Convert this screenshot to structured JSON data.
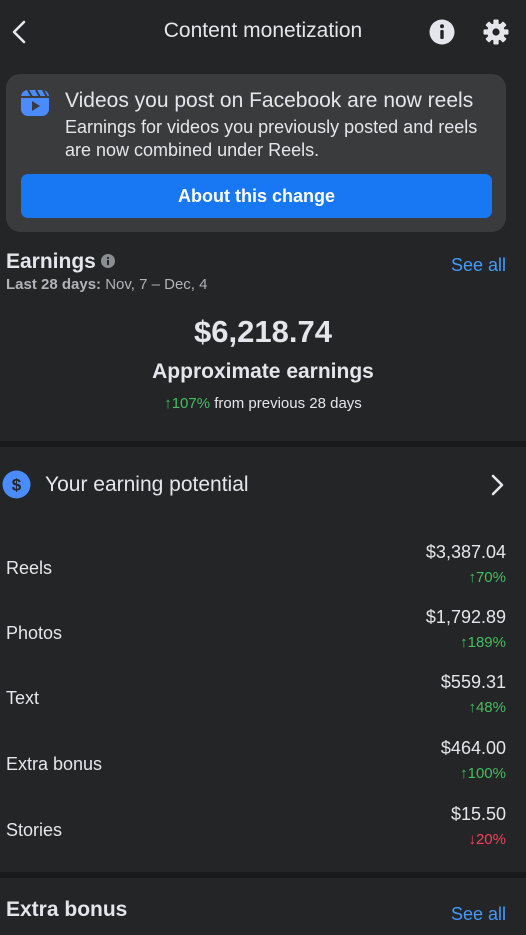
{
  "header": {
    "title": "Content monetization"
  },
  "banner": {
    "title": "Videos you post on Facebook are now reels",
    "body": "Earnings for videos you previously posted and reels are now combined under Reels.",
    "button_label": "About this change"
  },
  "earnings": {
    "heading": "Earnings",
    "see_all": "See all",
    "period_label": "Last 28 days:",
    "period_range": "Nov, 7 – Dec, 4",
    "amount": "$6,218.74",
    "amount_label": "Approximate earnings",
    "change": "↑107%",
    "change_suffix": "from previous 28 days"
  },
  "potential": {
    "label": "Your earning potential"
  },
  "breakdown": [
    {
      "label": "Reels",
      "value": "$3,387.04",
      "change": "↑70%",
      "direction": "up"
    },
    {
      "label": "Photos",
      "value": "$1,792.89",
      "change": "↑189%",
      "direction": "up"
    },
    {
      "label": "Text",
      "value": "$559.31",
      "change": "↑48%",
      "direction": "up"
    },
    {
      "label": "Extra bonus",
      "value": "$464.00",
      "change": "↑100%",
      "direction": "up"
    },
    {
      "label": "Stories",
      "value": "$15.50",
      "change": "↓20%",
      "direction": "down"
    }
  ],
  "extra_bonus": {
    "heading": "Extra bonus",
    "see_all": "See all"
  },
  "colors": {
    "background": "#242526",
    "card": "#3a3b3c",
    "accent": "#1877f2",
    "link": "#4599ff",
    "positive": "#45bd62",
    "negative": "#f3425f"
  }
}
